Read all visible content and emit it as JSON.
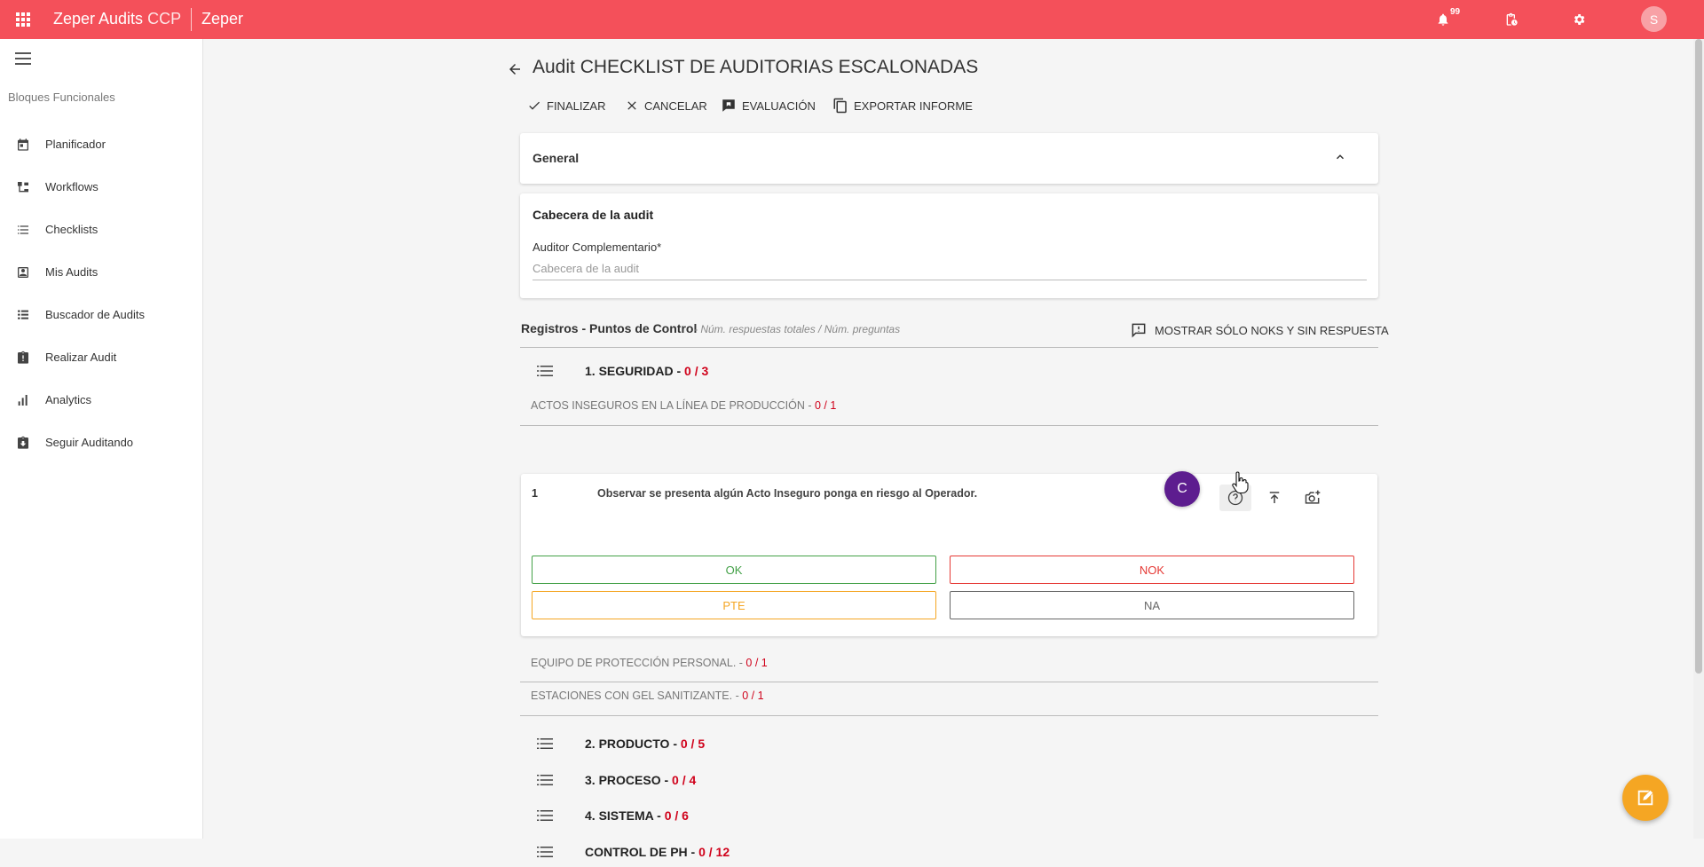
{
  "topbar": {
    "brand_main": "Zeper Audits",
    "brand_suffix": "CCP",
    "tenant": "Zeper",
    "notifications_count": "99",
    "avatar_initial": "S",
    "bg_color": "#f4505a"
  },
  "sidebar": {
    "section_title": "Bloques Funcionales",
    "items": [
      {
        "label": "Planificador",
        "icon": "calendar-icon"
      },
      {
        "label": "Workflows",
        "icon": "workflow-icon"
      },
      {
        "label": "Checklists",
        "icon": "checklist-icon"
      },
      {
        "label": "Mis Audits",
        "icon": "contact-card-icon"
      },
      {
        "label": "Buscador de Audits",
        "icon": "list-icon"
      },
      {
        "label": "Realizar Audit",
        "icon": "clipboard-alert-icon"
      },
      {
        "label": "Analytics",
        "icon": "bar-chart-icon"
      },
      {
        "label": "Seguir Auditando",
        "icon": "clipboard-download-icon"
      }
    ]
  },
  "page": {
    "title": "Audit CHECKLIST DE AUDITORIAS ESCALONADAS",
    "actions": {
      "finalizar": "FINALIZAR",
      "cancelar": "CANCELAR",
      "evaluacion": "EVALUACIÓN",
      "exportar": "EXPORTAR INFORME"
    }
  },
  "general": {
    "label": "General"
  },
  "cabecera": {
    "title": "Cabecera de la audit",
    "field_label": "Auditor Complementario*",
    "field_placeholder": "Cabecera de la audit",
    "field_value": ""
  },
  "registros": {
    "title": "Registros - Puntos de Control",
    "subtitle": "- Núm. respuestas totales / Núm. preguntas",
    "show_noks": "MOSTRAR SÓLO NOKS Y SIN RESPUESTA"
  },
  "sections": [
    {
      "title": "1. SEGURIDAD - ",
      "count": "0 / 3"
    },
    {
      "title": "2. PRODUCTO - ",
      "count": "0 / 5"
    },
    {
      "title": "3. PROCESO - ",
      "count": "0 / 4"
    },
    {
      "title": "4. SISTEMA - ",
      "count": "0 / 6"
    },
    {
      "title": "CONTROL DE PH - ",
      "count": "0 / 12"
    }
  ],
  "subsections": [
    {
      "title": "ACTOS INSEGUROS EN LA LÍNEA DE PRODUCCIÓN - ",
      "count": "0 / 1"
    },
    {
      "title": "EQUIPO DE PROTECCIÓN PERSONAL. - ",
      "count": "0 / 1"
    },
    {
      "title": "ESTACIONES CON GEL SANITIZANTE. - ",
      "count": "0 / 1"
    }
  ],
  "question": {
    "number": "1",
    "text": "Observar se presenta algún Acto Inseguro ponga en riesgo al  Operador.",
    "answers": {
      "ok": "OK",
      "nok": "NOK",
      "pte": "PTE",
      "na": "NA"
    }
  },
  "cursor_badge": "C"
}
